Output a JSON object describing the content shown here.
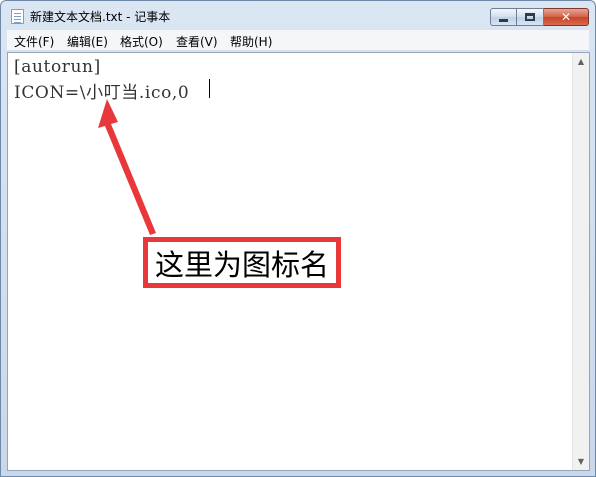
{
  "window": {
    "title": "新建文本文档.txt - 记事本",
    "buttons": {
      "minimize": "minimize",
      "maximize": "maximize",
      "close": "✕"
    }
  },
  "menubar": {
    "items": [
      {
        "label": "文件(F)"
      },
      {
        "label": "编辑(E)"
      },
      {
        "label": "格式(O)"
      },
      {
        "label": "查看(V)"
      },
      {
        "label": "帮助(H)"
      }
    ]
  },
  "editor": {
    "lines": [
      "[autorun]",
      "ICON=\\小叮当.ico,0"
    ]
  },
  "annotation": {
    "text": "这里为图标名",
    "color": "#e8383a"
  },
  "icons": {
    "app": "notepad-icon",
    "scroll_up": "scroll-up-arrow-icon",
    "scroll_down": "scroll-down-arrow-icon"
  }
}
